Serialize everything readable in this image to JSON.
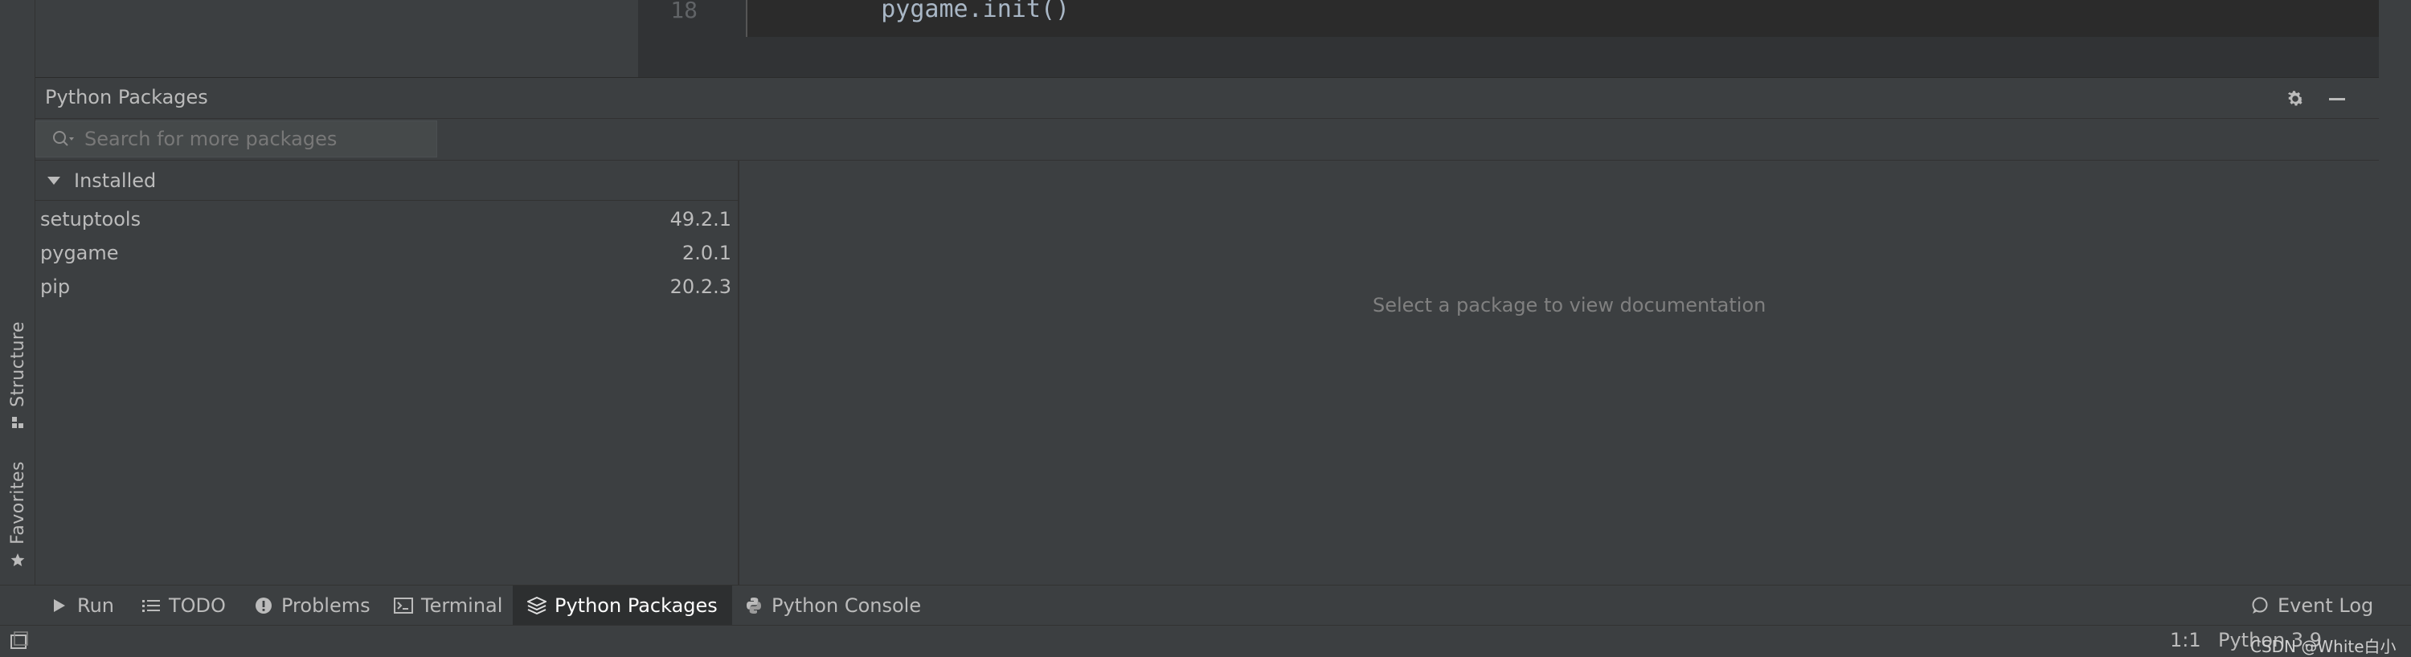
{
  "editor": {
    "line_number": "18",
    "code_line": "    pygame.init()"
  },
  "left_strip": {
    "structure_label": "Structure",
    "structure_icon": "structure-icon",
    "favorites_label": "Favorites",
    "favorites_icon": "star-icon"
  },
  "tool_window": {
    "title": "Python Packages",
    "settings_icon": "gear-icon",
    "minimize_icon": "minimize-icon"
  },
  "search": {
    "placeholder": "Search for more packages",
    "value": ""
  },
  "packages": {
    "group_label": "Installed",
    "items": [
      {
        "name": "setuptools",
        "version": "49.2.1"
      },
      {
        "name": "pygame",
        "version": "2.0.1"
      },
      {
        "name": "pip",
        "version": "20.2.3"
      }
    ]
  },
  "documentation": {
    "placeholder": "Select a package to view documentation"
  },
  "tool_bar": {
    "tabs": [
      {
        "label": "Run",
        "icon": "play-icon"
      },
      {
        "label": "TODO",
        "icon": "list-icon"
      },
      {
        "label": "Problems",
        "icon": "info-icon"
      },
      {
        "label": "Terminal",
        "icon": "terminal-icon"
      },
      {
        "label": "Python Packages",
        "icon": "packages-icon"
      },
      {
        "label": "Python Console",
        "icon": "python-icon"
      }
    ],
    "active_tab": "Python Packages",
    "event_log": "Event Log"
  },
  "status_bar": {
    "caret": "1:1",
    "interpreter": "Python 3.9",
    "watermark": "CSDN @White白小"
  },
  "colors": {
    "background": "#3c3f41",
    "editor_bg": "#2b2b2b",
    "text": "#bbbbbb",
    "muted_text": "#808080"
  }
}
